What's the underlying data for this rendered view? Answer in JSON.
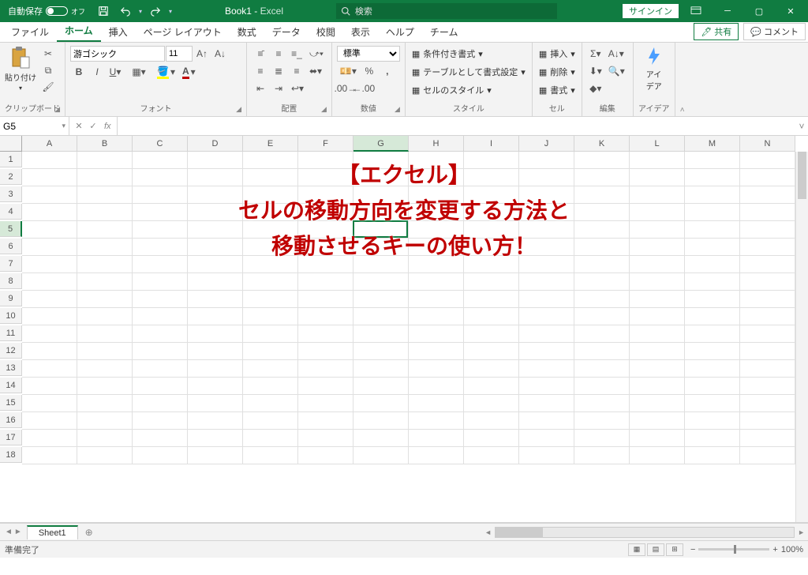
{
  "titlebar": {
    "autosave_label": "自動保存",
    "autosave_state": "オフ",
    "doc_title": "Book1",
    "app_name": "Excel",
    "search_placeholder": "検索",
    "signin": "サインイン"
  },
  "tabs": {
    "items": [
      "ファイル",
      "ホーム",
      "挿入",
      "ページ レイアウト",
      "数式",
      "データ",
      "校閲",
      "表示",
      "ヘルプ",
      "チーム"
    ],
    "active_index": 1,
    "share": "共有",
    "comment": "コメント"
  },
  "ribbon": {
    "clipboard": {
      "label": "クリップボード",
      "paste": "貼り付け"
    },
    "font": {
      "label": "フォント",
      "name": "游ゴシック",
      "size": "11"
    },
    "alignment": {
      "label": "配置"
    },
    "number": {
      "label": "数値",
      "format": "標準"
    },
    "styles": {
      "label": "スタイル",
      "cond": "条件付き書式",
      "table": "テーブルとして書式設定",
      "cell": "セルのスタイル"
    },
    "cells": {
      "label": "セル",
      "insert": "挿入",
      "delete": "削除",
      "format": "書式"
    },
    "editing": {
      "label": "編集"
    },
    "ideas": {
      "label": "アイデア",
      "btn": "アイ\nデア"
    }
  },
  "formula_bar": {
    "name_box": "G5",
    "formula": ""
  },
  "grid": {
    "columns": [
      "A",
      "B",
      "C",
      "D",
      "E",
      "F",
      "G",
      "H",
      "I",
      "J",
      "K",
      "L",
      "M",
      "N"
    ],
    "rows": [
      1,
      2,
      3,
      4,
      5,
      6,
      7,
      8,
      9,
      10,
      11,
      12,
      13,
      14,
      15,
      16,
      17,
      18
    ],
    "selected_col": "G",
    "selected_row": 5
  },
  "overlay": {
    "line1": "【エクセル】",
    "line2": "セルの移動方向を変更する方法と",
    "line3": "移動させるキーの使い方！"
  },
  "sheets": {
    "active": "Sheet1"
  },
  "status": {
    "ready": "準備完了",
    "zoom": "100%"
  }
}
